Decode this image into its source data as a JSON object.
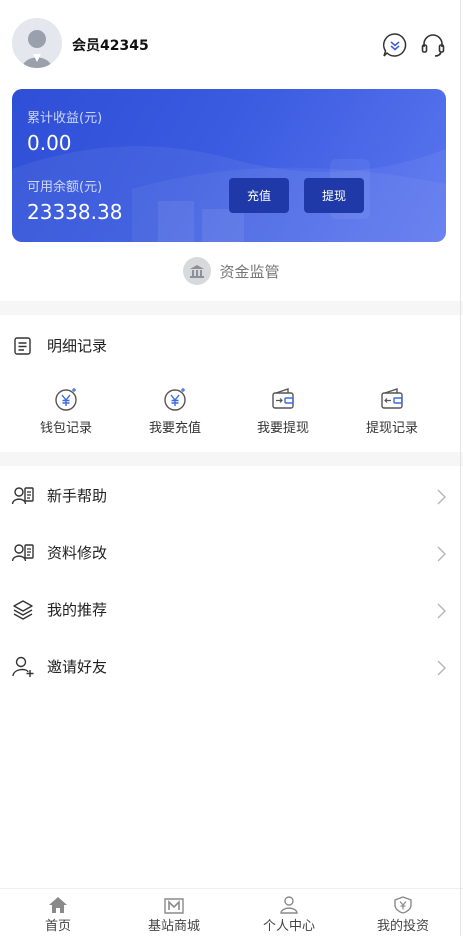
{
  "user": {
    "name": "会员42345"
  },
  "icons": {
    "message": "message-down-icon",
    "service": "headset-icon",
    "avatar": "user-avatar-icon"
  },
  "card": {
    "total_income_label": "累计收益(元)",
    "total_income_value": "0.00",
    "balance_label": "可用余额(元)",
    "balance_value": "23338.38",
    "recharge_label": "充值",
    "withdraw_label": "提现",
    "colors": {
      "start": "#2e4fd6",
      "end": "#5a75ef",
      "button": "#1f3aa8"
    }
  },
  "supervise": {
    "label": "资金监管",
    "icon": "bank-icon"
  },
  "details": {
    "title": "明细记录",
    "icon": "list-icon",
    "items": [
      {
        "label": "钱包记录",
        "icon": "yuan-coin-icon"
      },
      {
        "label": "我要充值",
        "icon": "yuan-coin-icon"
      },
      {
        "label": "我要提现",
        "icon": "wallet-out-icon"
      },
      {
        "label": "提现记录",
        "icon": "wallet-in-icon"
      }
    ]
  },
  "menu": [
    {
      "label": "新手帮助",
      "icon": "user-card-icon"
    },
    {
      "label": "资料修改",
      "icon": "user-card-icon"
    },
    {
      "label": "我的推荐",
      "icon": "layers-icon"
    },
    {
      "label": "邀请好友",
      "icon": "user-add-icon"
    }
  ],
  "tabbar": [
    {
      "label": "首页",
      "icon": "home-icon"
    },
    {
      "label": "基站商城",
      "icon": "store-icon"
    },
    {
      "label": "个人中心",
      "icon": "user-icon"
    },
    {
      "label": "我的投资",
      "icon": "shield-yuan-icon"
    }
  ]
}
